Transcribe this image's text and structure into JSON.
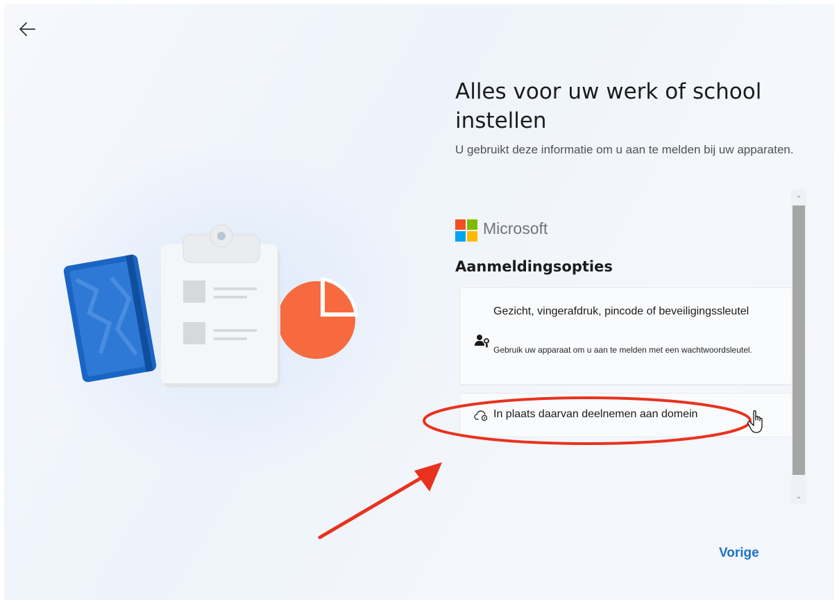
{
  "header": {
    "back_icon": "arrow-left-icon",
    "title": "Alles voor uw werk of school instellen",
    "subtitle": "U gebruikt deze informatie om u aan te melden bij uw apparaten."
  },
  "brand": {
    "name": "Microsoft",
    "logo_colors": [
      "#f25022",
      "#7fba00",
      "#00a4ef",
      "#ffb900"
    ]
  },
  "signin": {
    "section_title": "Aanmeldingsopties",
    "options": [
      {
        "icon": "person-key-icon",
        "title": "Gezicht, vingerafdruk, pincode of beveiligingssleutel",
        "description": "Gebruik uw apparaat om u aan te melden met een wachtwoordsleutel."
      },
      {
        "icon": "cloud-settings-icon",
        "title": "In plaats daarvan deelnemen aan domein"
      }
    ]
  },
  "footer": {
    "next_label": "Vorige"
  },
  "colors": {
    "accent": "#1a73c8",
    "annotation_red": "#e8321e"
  }
}
